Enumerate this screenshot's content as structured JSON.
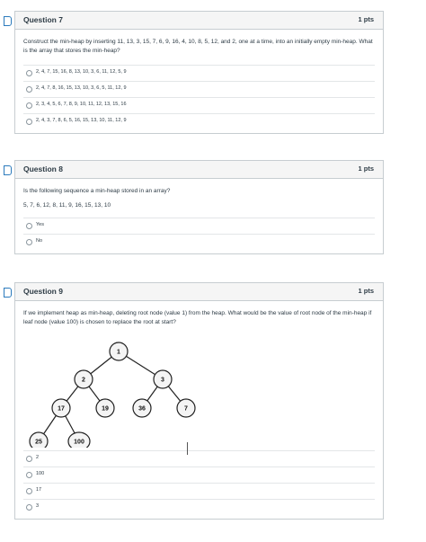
{
  "questions": [
    {
      "title": "Question 7",
      "points": "1 pts",
      "text": "Construct the min-heap by inserting 11, 13, 3, 15, 7, 6, 9, 16, 4, 10, 8, 5, 12, and 2, one at a time, into an initially empty min-heap. What is the array that stores the min-heap?",
      "answers": [
        "2, 4, 7, 15, 16, 8, 13, 10, 3, 6, 11, 12, 5, 9",
        "2, 4, 7, 8, 16, 15, 13, 10, 3, 6, 5, 11, 12, 9",
        "2, 3, 4, 5, 6, 7, 8, 9, 10, 11, 12, 13, 15, 16",
        "2, 4, 3, 7, 8, 6, 5, 16, 15, 13, 10, 11, 12, 9"
      ]
    },
    {
      "title": "Question 8",
      "points": "1 pts",
      "text": "Is the following sequence a min-heap stored in an array?",
      "sequence": "5, 7, 6, 12, 8, 11, 9, 16, 15, 13, 10",
      "answers": [
        "Yes",
        "No"
      ]
    },
    {
      "title": "Question 9",
      "points": "1 pts",
      "text": "If we implement heap as min-heap, deleting root node (value 1) from the heap. What would be the value of root node of the min-heap if leaf node (value 100) is chosen to replace the root at start?",
      "tree_nodes": [
        "1",
        "2",
        "3",
        "17",
        "19",
        "36",
        "7",
        "25",
        "100"
      ],
      "answers": [
        "2",
        "100",
        "17",
        "3"
      ]
    }
  ]
}
